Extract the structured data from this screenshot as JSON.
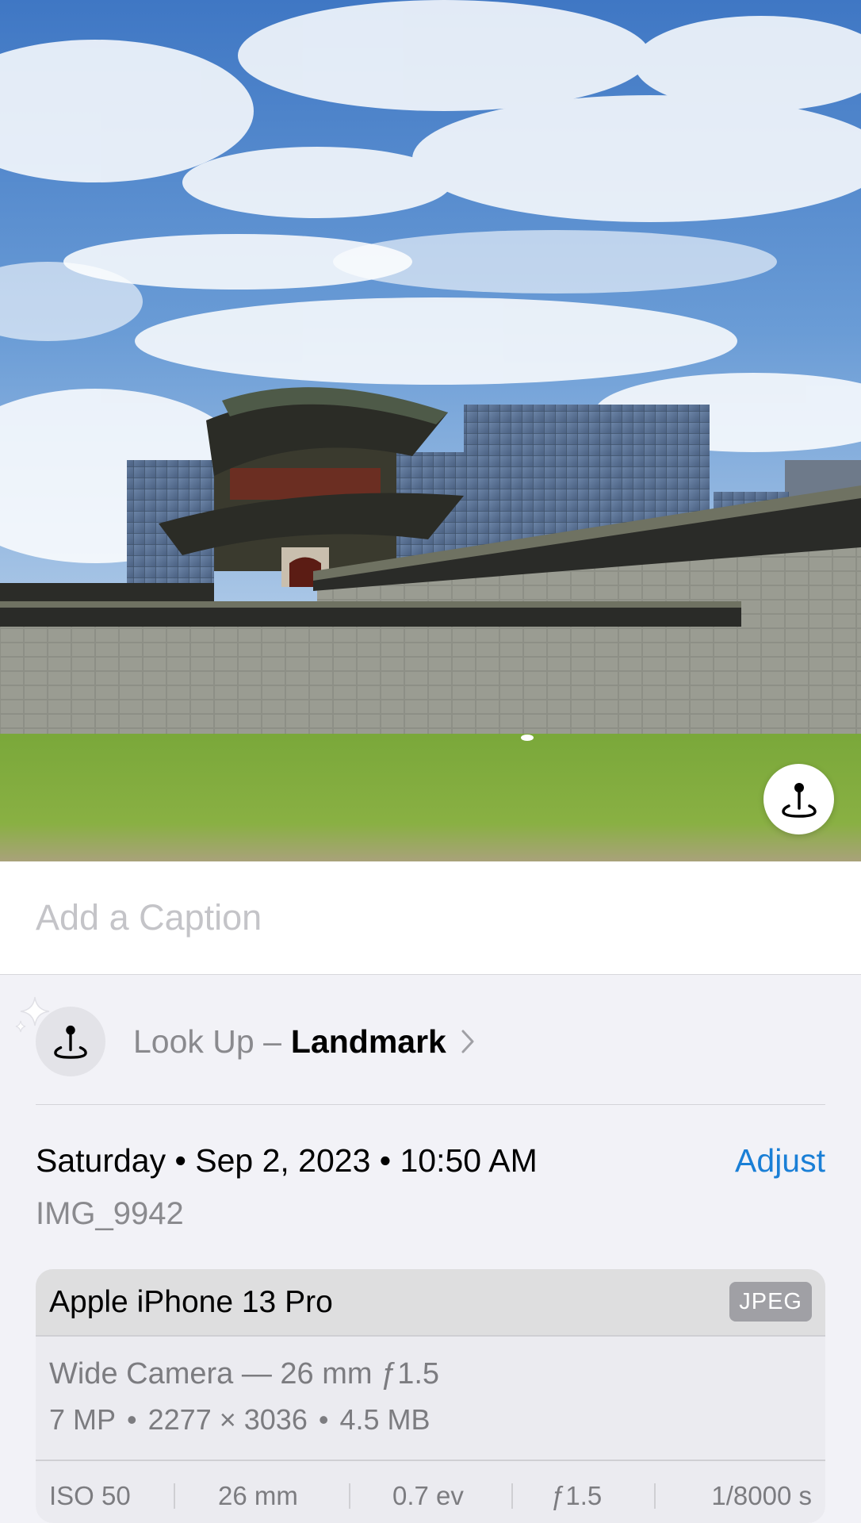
{
  "caption": {
    "placeholder": "Add a Caption"
  },
  "lookup": {
    "prefix": "Look Up –",
    "subject": "Landmark",
    "icon": "landmark-pin-icon",
    "badge_icon": "landmark-pin-icon",
    "sparkle_icon": "sparkle-icon"
  },
  "date": {
    "text": "Saturday • Sep 2, 2023 • 10:50 AM",
    "adjust_label": "Adjust"
  },
  "file_name": "IMG_9942",
  "device": {
    "name": "Apple iPhone 13 Pro",
    "format": "JPEG",
    "lens": "Wide Camera — 26 mm ƒ1.5",
    "megapixels": "7 MP",
    "resolution": "2277 × 3036",
    "file_size": "4.5 MB",
    "separator": "•"
  },
  "exif": {
    "iso": "ISO 50",
    "focal_length": "26 mm",
    "exposure_value": "0.7 ev",
    "aperture": "ƒ1.5",
    "shutter": "1/8000 s"
  },
  "colors": {
    "accent": "#1a7fd6",
    "background": "#f2f2f7",
    "secondary_text": "#8a8a8e"
  }
}
